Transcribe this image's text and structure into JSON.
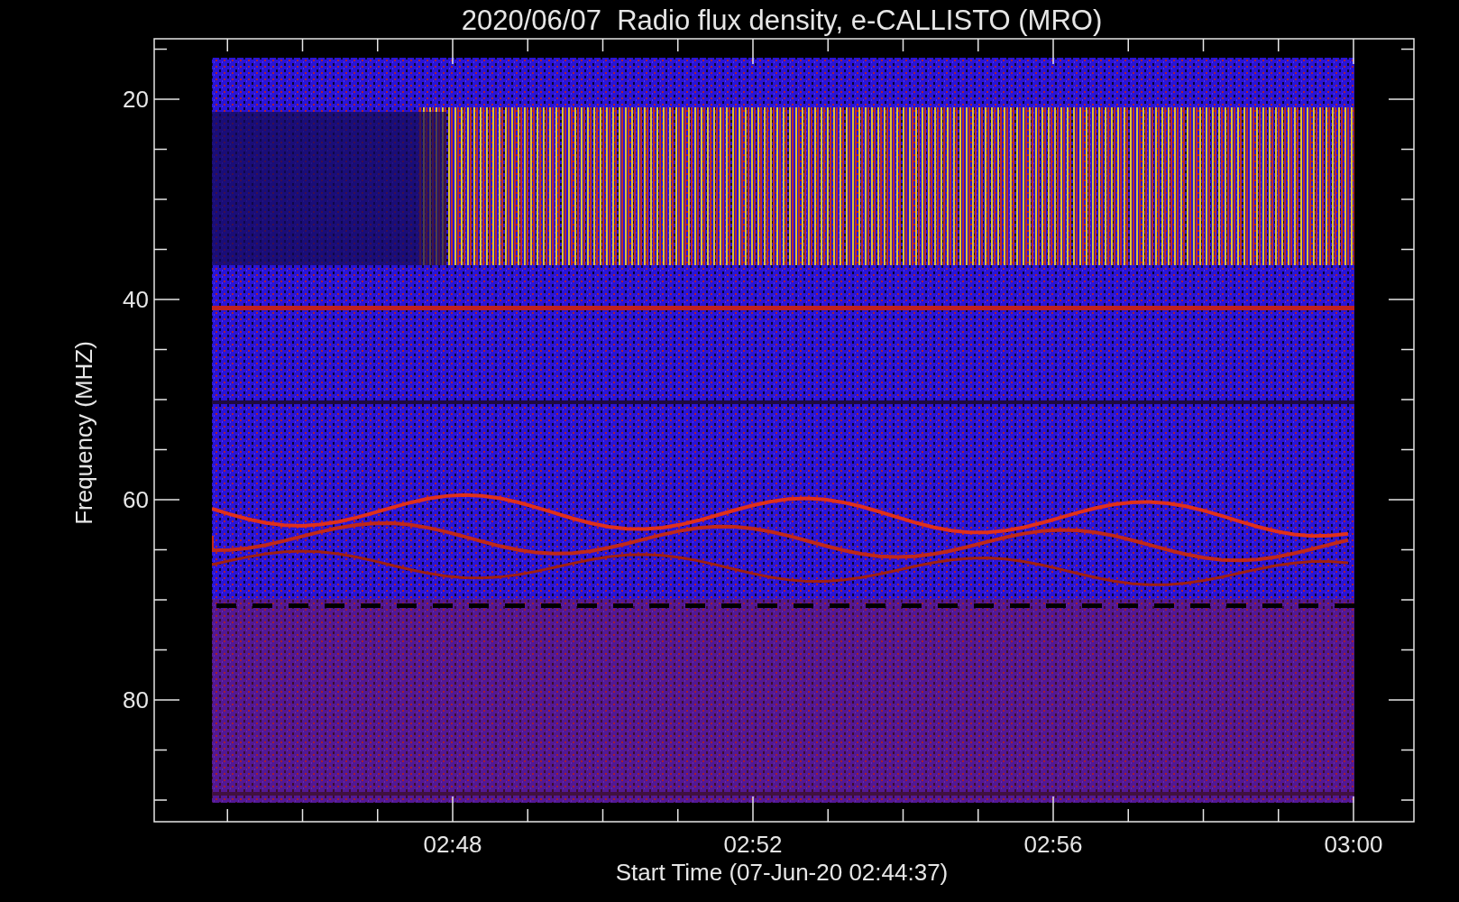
{
  "title": "2020/06/07  Radio flux density, e-CALLISTO (MRO)",
  "y_axis": {
    "label": "Frequency (MHZ)",
    "ticks": [
      "20",
      "40",
      "60",
      "80"
    ]
  },
  "x_axis": {
    "label": "Start Time (07-Jun-20 02:44:37)",
    "ticks": [
      "02:48",
      "02:52",
      "02:56",
      "03:00"
    ]
  }
}
